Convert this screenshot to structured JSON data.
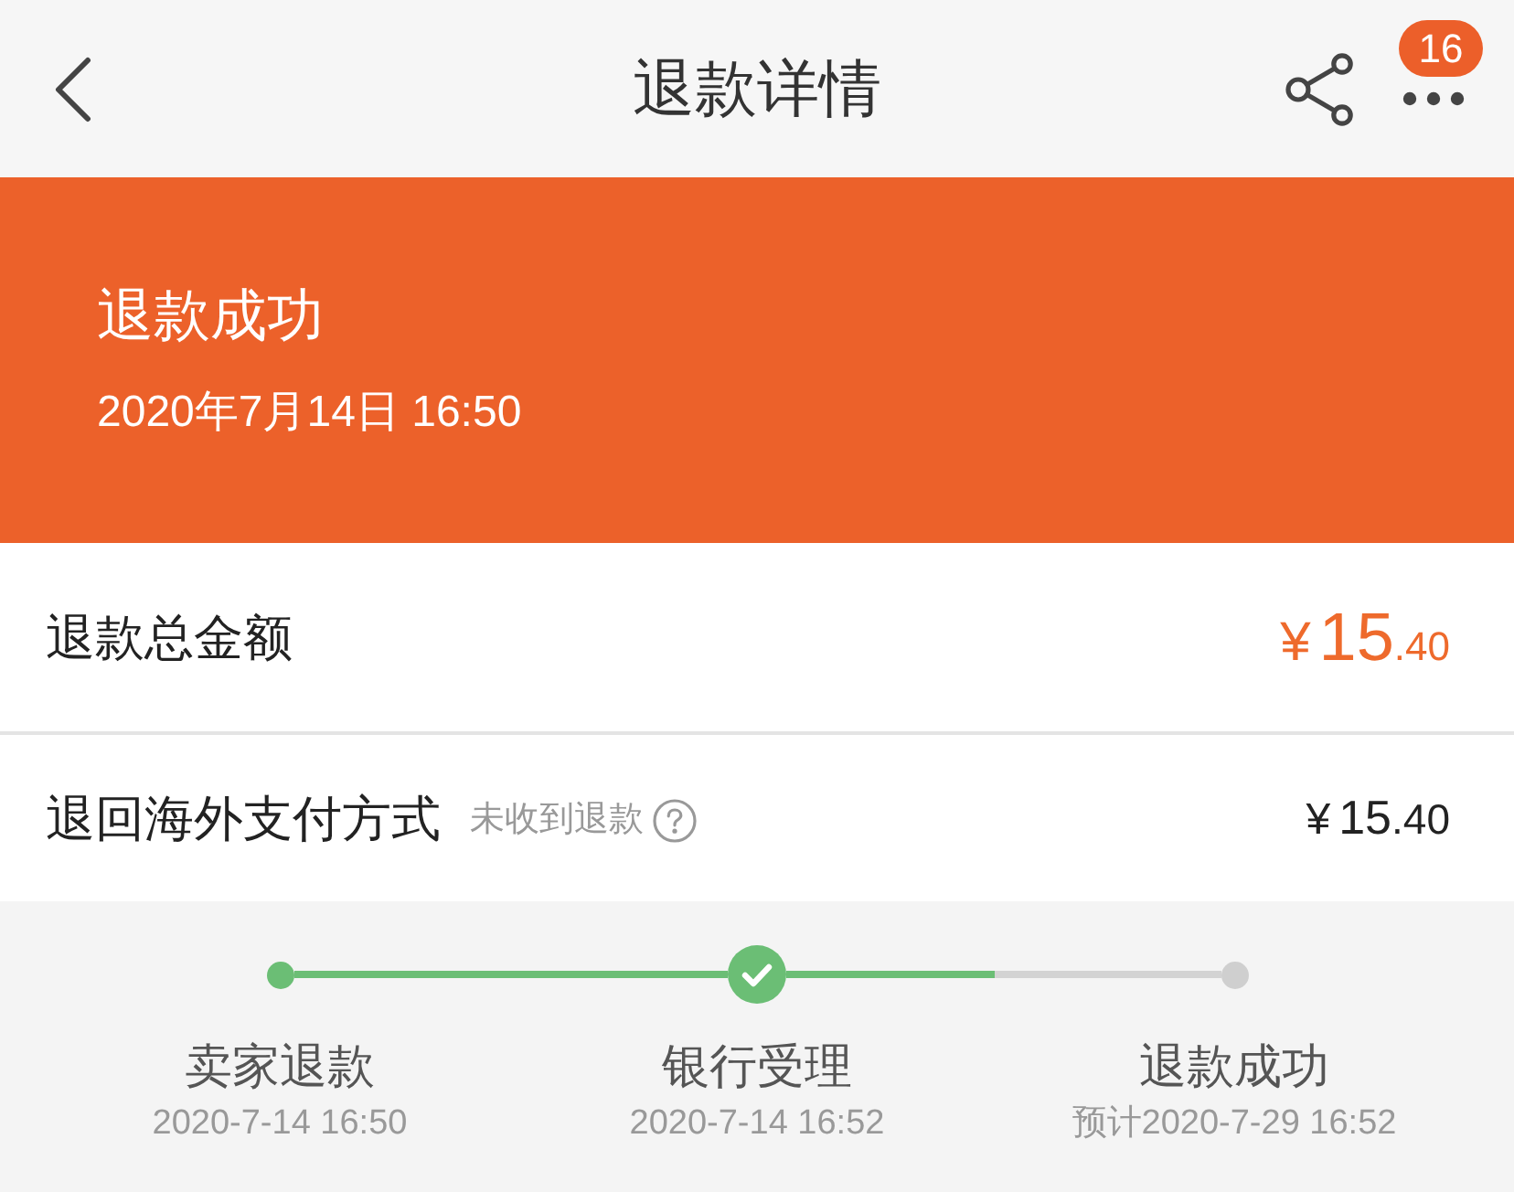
{
  "nav": {
    "title": "退款详情",
    "badge": "16"
  },
  "banner": {
    "status": "退款成功",
    "time": "2020年7月14日 16:50"
  },
  "rows": [
    {
      "kind": "total",
      "label": "退款总金额",
      "amount": {
        "symbol": "¥",
        "whole": "15",
        "fraction": ".40"
      }
    },
    {
      "kind": "method",
      "label": "退回海外支付方式",
      "note": "未收到退款",
      "amount": {
        "symbol": "¥",
        "whole": "15",
        "fraction": ".40"
      }
    }
  ],
  "progress": {
    "steps": [
      {
        "kind": "done",
        "label": "卖家退款",
        "time": "2020-7-14 16:50"
      },
      {
        "kind": "current",
        "level": 0.48,
        "label": "银行受理",
        "time": "2020-7-14 16:52"
      },
      {
        "kind": "pending",
        "label": "退款成功",
        "time": "预计2020-7-29 16:52"
      }
    ]
  }
}
